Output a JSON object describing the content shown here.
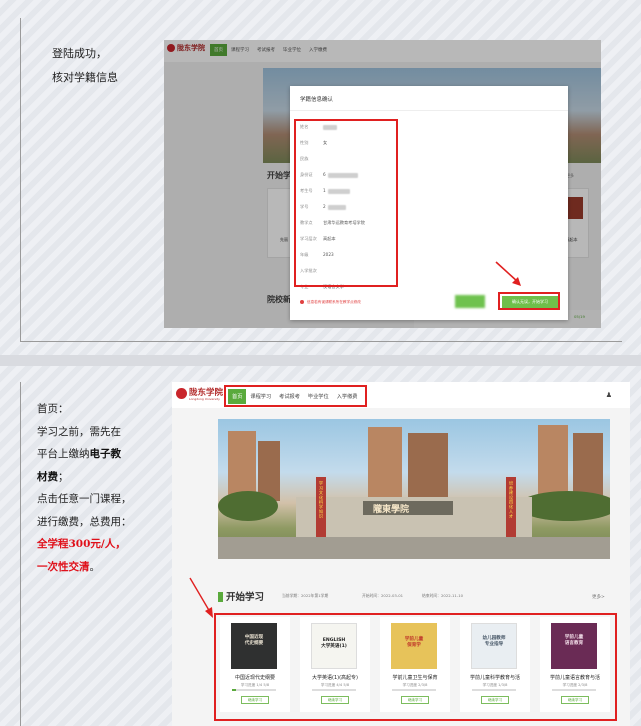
{
  "slide1": {
    "caption_lines": [
      "登陆成功，",
      "核对学籍信息"
    ],
    "screenshot": {
      "logo_text": "陇东学院",
      "nav_tabs": [
        "首页",
        "课程学习",
        "考试报考",
        "毕业学位",
        "入学缴费"
      ],
      "modal": {
        "title": "学籍信息确认",
        "fields": [
          {
            "label": "姓名",
            "value": ""
          },
          {
            "label": "性别",
            "value": "女"
          },
          {
            "label": "民族",
            "value": ""
          },
          {
            "label": "身份证",
            "value": "6"
          },
          {
            "label": "考生号",
            "value": "1"
          },
          {
            "label": "学号",
            "value": "2"
          },
          {
            "label": "教学点",
            "value": "甘肃华远教育考培学院"
          },
          {
            "label": "学习层次",
            "value": "高起本"
          },
          {
            "label": "年级",
            "value": "2023"
          },
          {
            "label": "入学批次",
            "value": ""
          },
          {
            "label": "专业",
            "value": "汉语言文学"
          }
        ],
        "warning": "信息若有误请联系所在教学点修改",
        "confirm_label": "确认无误，开始学习"
      },
      "background": {
        "heading_1": "开始学",
        "heading_2": "院校新",
        "card_text": "(高起本",
        "card_text_2": "先丽",
        "more": "更多",
        "bottom_left": "通知",
        "bottom_right": "05/19"
      }
    }
  },
  "slide2": {
    "caption": {
      "line1": "首页：",
      "line2": "学习之前，需先在",
      "line3_plain": "平台上缴纳",
      "line3_bold": "电子教",
      "line4_bold": "材费",
      "line4_plain": "；",
      "line5": "点击任意一门课程，",
      "line6": "进行缴费，总费用：",
      "line7_red": "全学程300元/人，",
      "line8_red": "一次性交清",
      "line8_plain": "。"
    },
    "screenshot": {
      "logo_text": "陇东学院",
      "logo_sub": "Longdong University",
      "nav_tabs": [
        "首页",
        "课程学习",
        "考试报考",
        "毕业学位",
        "入学缴费"
      ],
      "user_icon": "user-icon",
      "banner": {
        "gate_sign": "隴東學院",
        "left_pillar": "学习文化科学知识",
        "right_pillar": "培养建设四化人才"
      },
      "section": {
        "title": "开始学习",
        "term": "当前学期：2022年第1学期",
        "start": "开始时间：2022-03-01",
        "end": "结束时间：2022-11-10",
        "more": "更多>"
      },
      "courses": [
        {
          "title": "中国近现代史纲要",
          "progress_text": "学习进度 1/4 5/8",
          "progress": 0.1,
          "button": "继续学习",
          "cover_text": "中国近现\n代史纲要",
          "cover_bg": "#2f3030",
          "cover_fg": "#e8e0d0"
        },
        {
          "title": "大学英语(1)(高起专)",
          "progress_text": "学习进度 4/4 5/8",
          "progress": 0.0,
          "button": "继续学习",
          "cover_text": "ENGLISH\n大学英语(1)",
          "cover_bg": "#f5f5f0",
          "cover_fg": "#222222"
        },
        {
          "title": "学前儿童卫生与保育",
          "progress_text": "学习进度 2/3/8",
          "progress": 0.0,
          "button": "继续学习",
          "cover_text": "学前儿童\n保育学",
          "cover_bg": "#e7c35a",
          "cover_fg": "#c0392b"
        },
        {
          "title": "学前儿童科学教育与活",
          "progress_text": "学习进度 1/3/8",
          "progress": 0.0,
          "button": "继续学习",
          "cover_text": "幼儿园教师\n专业指导",
          "cover_bg": "#e9eef2",
          "cover_fg": "#4a5a6a"
        },
        {
          "title": "学前儿童语言教育与活",
          "progress_text": "学习进度 2/3/8",
          "progress": 0.0,
          "button": "继续学习",
          "cover_text": "学前儿童\n语言教育",
          "cover_bg": "#6a2b55",
          "cover_fg": "#f0dbe6"
        }
      ]
    }
  },
  "colors": {
    "accent_green": "#5aaa3c",
    "highlight_red": "#e02020",
    "brand_red": "#b22a2a"
  }
}
